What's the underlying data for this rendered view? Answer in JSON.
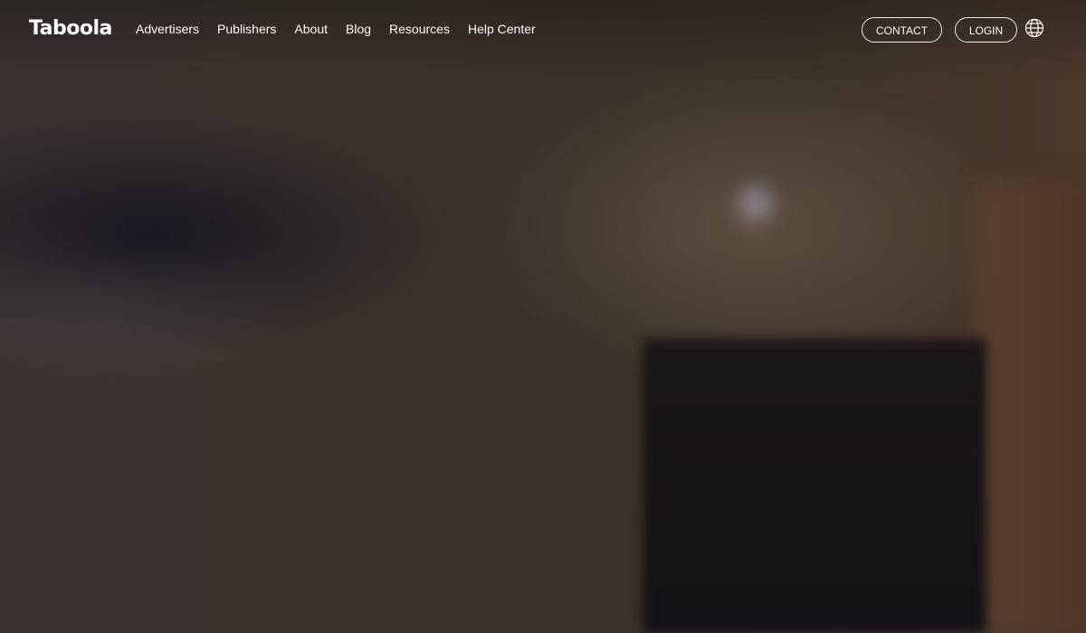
{
  "brand": {
    "logo_text": "Taboola"
  },
  "nav": {
    "items": [
      {
        "label": "Advertisers"
      },
      {
        "label": "Publishers"
      },
      {
        "label": "About"
      },
      {
        "label": "Blog"
      },
      {
        "label": "Resources"
      },
      {
        "label": "Help Center"
      }
    ]
  },
  "actions": {
    "contact_label": "CONTACT",
    "login_label": "LOGIN",
    "language_icon": "globe-icon"
  },
  "colors": {
    "header_text": "#ffffff"
  }
}
